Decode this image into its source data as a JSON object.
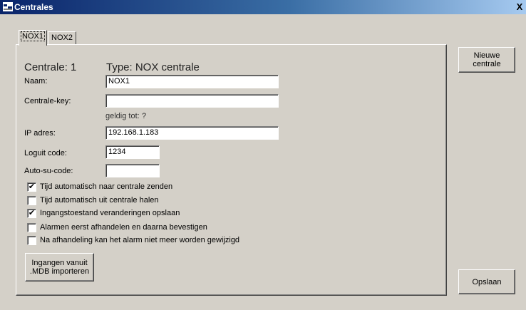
{
  "window": {
    "title": "Centrales",
    "close_glyph": "X"
  },
  "tabs": [
    {
      "label": "NOX1"
    },
    {
      "label": "NOX2"
    }
  ],
  "panel": {
    "centrale_label": "Centrale: 1",
    "type_label": "Type: NOX centrale",
    "naam_label": "Naam:",
    "naam_value": "NOX1",
    "key_label": "Centrale-key:",
    "key_value": "",
    "geldig_label": "geldig tot:",
    "geldig_value": "?",
    "ip_label": "IP adres:",
    "ip_value": "192.168.1.183",
    "loguit_label": "Loguit code:",
    "loguit_value": "1234",
    "autosu_label": "Auto-su-code:",
    "autosu_value": ""
  },
  "checkboxes": [
    {
      "label": "Tijd automatisch naar centrale zenden",
      "checked": true
    },
    {
      "label": "Tijd automatisch uit centrale halen",
      "checked": false
    },
    {
      "label": "Ingangstoestand veranderingen opslaan",
      "checked": true
    },
    {
      "label": "Alarmen eerst afhandelen en daarna bevestigen",
      "checked": false
    },
    {
      "label": "Na afhandeling kan het alarm niet meer worden gewijzigd",
      "checked": false
    }
  ],
  "buttons": {
    "import_line1": "Ingangen vanuit",
    "import_line2": ".MDB importeren",
    "nieuwe": "Nieuwe centrale",
    "opslaan": "Opslaan"
  }
}
